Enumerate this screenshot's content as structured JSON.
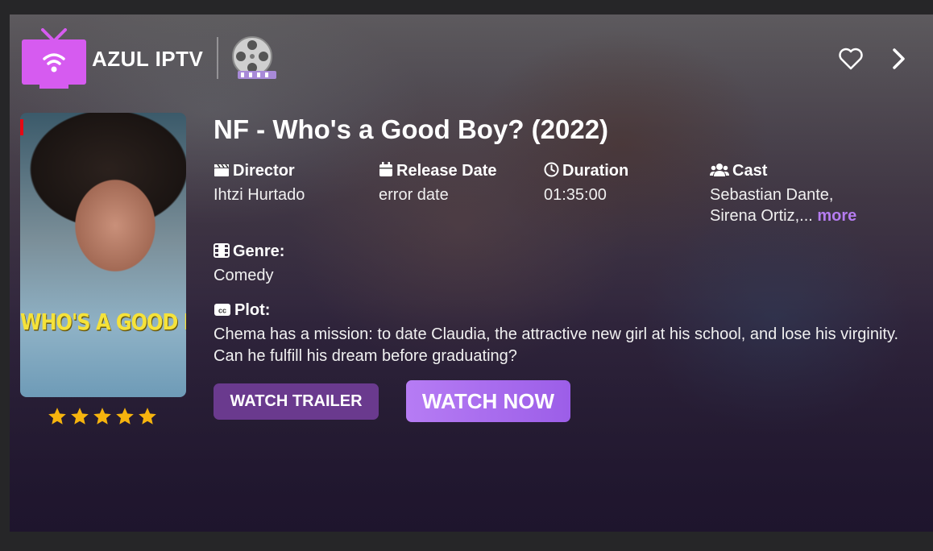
{
  "app": {
    "brand": "AZUL IPTV"
  },
  "icons": {
    "logo": "tv-wifi-icon",
    "reel": "film-reel-icon",
    "favorite": "heart-icon",
    "next": "chevron-right-icon",
    "director": "clapperboard-icon",
    "release": "calendar-icon",
    "duration": "clock-icon",
    "cast": "users-icon",
    "genre": "film-icon",
    "plot": "cc-icon",
    "rating": "star-icon"
  },
  "colors": {
    "accent": "#b57cf0",
    "logo": "#d65bf0",
    "trailer_button": "#6a3a8e",
    "watch_button": "#a86cf0",
    "stars": "#f6b40e"
  },
  "movie": {
    "title": "NF - Who's a Good Boy? (2022)",
    "poster_title": "WHO'S A GOOD BOY?",
    "rating_stars": 5,
    "director_label": "Director",
    "director": "Ihtzi Hurtado",
    "release_label": "Release Date",
    "release": "error date",
    "duration_label": "Duration",
    "duration": "01:35:00",
    "cast_label": "Cast",
    "cast_line1": "Sebastian Dante,",
    "cast_line2": "Sirena Ortiz,...",
    "cast_more": "more",
    "genre_label": "Genre:",
    "genre": "Comedy",
    "plot_label": "Plot:",
    "plot": "Chema has a mission: to date Claudia, the attractive new girl at his school, and lose his virginity. Can he fulfill his dream before graduating?"
  },
  "actions": {
    "trailer": "WATCH TRAILER",
    "watch": "WATCH NOW"
  }
}
